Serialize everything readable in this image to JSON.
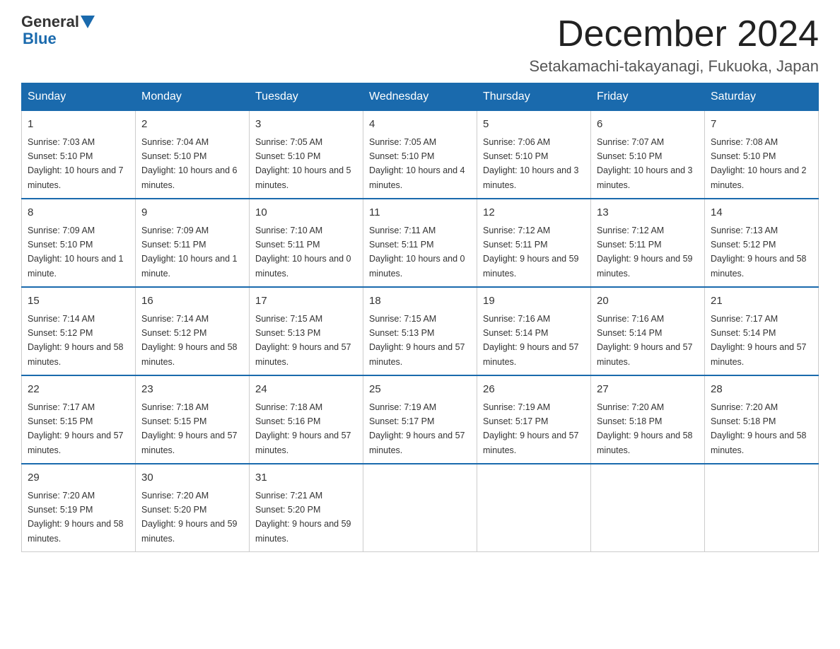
{
  "logo": {
    "general": "General",
    "blue": "Blue"
  },
  "title": "December 2024",
  "location": "Setakamachi-takayanagi, Fukuoka, Japan",
  "days_of_week": [
    "Sunday",
    "Monday",
    "Tuesday",
    "Wednesday",
    "Thursday",
    "Friday",
    "Saturday"
  ],
  "weeks": [
    [
      {
        "day": "1",
        "sunrise": "7:03 AM",
        "sunset": "5:10 PM",
        "daylight": "10 hours and 7 minutes."
      },
      {
        "day": "2",
        "sunrise": "7:04 AM",
        "sunset": "5:10 PM",
        "daylight": "10 hours and 6 minutes."
      },
      {
        "day": "3",
        "sunrise": "7:05 AM",
        "sunset": "5:10 PM",
        "daylight": "10 hours and 5 minutes."
      },
      {
        "day": "4",
        "sunrise": "7:05 AM",
        "sunset": "5:10 PM",
        "daylight": "10 hours and 4 minutes."
      },
      {
        "day": "5",
        "sunrise": "7:06 AM",
        "sunset": "5:10 PM",
        "daylight": "10 hours and 3 minutes."
      },
      {
        "day": "6",
        "sunrise": "7:07 AM",
        "sunset": "5:10 PM",
        "daylight": "10 hours and 3 minutes."
      },
      {
        "day": "7",
        "sunrise": "7:08 AM",
        "sunset": "5:10 PM",
        "daylight": "10 hours and 2 minutes."
      }
    ],
    [
      {
        "day": "8",
        "sunrise": "7:09 AM",
        "sunset": "5:10 PM",
        "daylight": "10 hours and 1 minute."
      },
      {
        "day": "9",
        "sunrise": "7:09 AM",
        "sunset": "5:11 PM",
        "daylight": "10 hours and 1 minute."
      },
      {
        "day": "10",
        "sunrise": "7:10 AM",
        "sunset": "5:11 PM",
        "daylight": "10 hours and 0 minutes."
      },
      {
        "day": "11",
        "sunrise": "7:11 AM",
        "sunset": "5:11 PM",
        "daylight": "10 hours and 0 minutes."
      },
      {
        "day": "12",
        "sunrise": "7:12 AM",
        "sunset": "5:11 PM",
        "daylight": "9 hours and 59 minutes."
      },
      {
        "day": "13",
        "sunrise": "7:12 AM",
        "sunset": "5:11 PM",
        "daylight": "9 hours and 59 minutes."
      },
      {
        "day": "14",
        "sunrise": "7:13 AM",
        "sunset": "5:12 PM",
        "daylight": "9 hours and 58 minutes."
      }
    ],
    [
      {
        "day": "15",
        "sunrise": "7:14 AM",
        "sunset": "5:12 PM",
        "daylight": "9 hours and 58 minutes."
      },
      {
        "day": "16",
        "sunrise": "7:14 AM",
        "sunset": "5:12 PM",
        "daylight": "9 hours and 58 minutes."
      },
      {
        "day": "17",
        "sunrise": "7:15 AM",
        "sunset": "5:13 PM",
        "daylight": "9 hours and 57 minutes."
      },
      {
        "day": "18",
        "sunrise": "7:15 AM",
        "sunset": "5:13 PM",
        "daylight": "9 hours and 57 minutes."
      },
      {
        "day": "19",
        "sunrise": "7:16 AM",
        "sunset": "5:14 PM",
        "daylight": "9 hours and 57 minutes."
      },
      {
        "day": "20",
        "sunrise": "7:16 AM",
        "sunset": "5:14 PM",
        "daylight": "9 hours and 57 minutes."
      },
      {
        "day": "21",
        "sunrise": "7:17 AM",
        "sunset": "5:14 PM",
        "daylight": "9 hours and 57 minutes."
      }
    ],
    [
      {
        "day": "22",
        "sunrise": "7:17 AM",
        "sunset": "5:15 PM",
        "daylight": "9 hours and 57 minutes."
      },
      {
        "day": "23",
        "sunrise": "7:18 AM",
        "sunset": "5:15 PM",
        "daylight": "9 hours and 57 minutes."
      },
      {
        "day": "24",
        "sunrise": "7:18 AM",
        "sunset": "5:16 PM",
        "daylight": "9 hours and 57 minutes."
      },
      {
        "day": "25",
        "sunrise": "7:19 AM",
        "sunset": "5:17 PM",
        "daylight": "9 hours and 57 minutes."
      },
      {
        "day": "26",
        "sunrise": "7:19 AM",
        "sunset": "5:17 PM",
        "daylight": "9 hours and 57 minutes."
      },
      {
        "day": "27",
        "sunrise": "7:20 AM",
        "sunset": "5:18 PM",
        "daylight": "9 hours and 58 minutes."
      },
      {
        "day": "28",
        "sunrise": "7:20 AM",
        "sunset": "5:18 PM",
        "daylight": "9 hours and 58 minutes."
      }
    ],
    [
      {
        "day": "29",
        "sunrise": "7:20 AM",
        "sunset": "5:19 PM",
        "daylight": "9 hours and 58 minutes."
      },
      {
        "day": "30",
        "sunrise": "7:20 AM",
        "sunset": "5:20 PM",
        "daylight": "9 hours and 59 minutes."
      },
      {
        "day": "31",
        "sunrise": "7:21 AM",
        "sunset": "5:20 PM",
        "daylight": "9 hours and 59 minutes."
      },
      null,
      null,
      null,
      null
    ]
  ]
}
